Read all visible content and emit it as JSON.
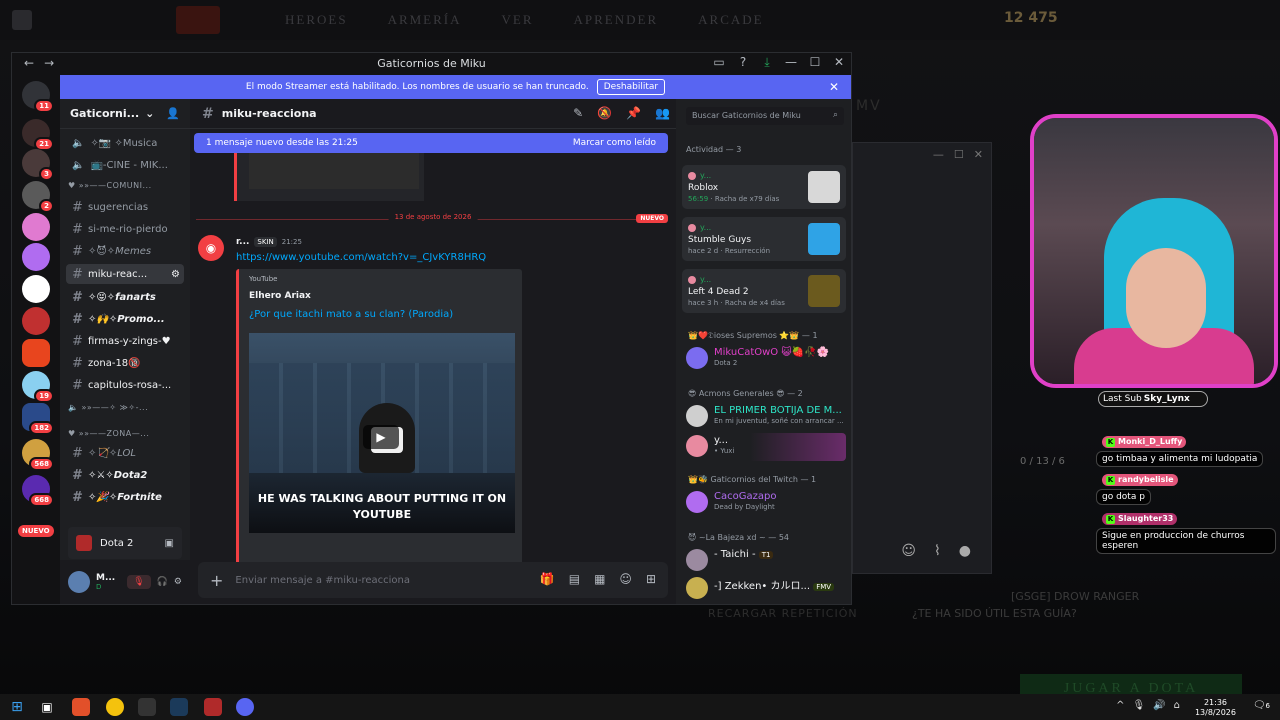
{
  "game": {
    "tabs": [
      "HEROES",
      "ARMERÍA",
      "VER",
      "APRENDER",
      "ARCADE"
    ],
    "gold": "12 475",
    "play_label": "JUGAR A DOTA",
    "footer_guide": "[GSGE] DROW RANGER",
    "footer_question": "¿TE HA SIDO ÚTIL ESTA GUÍA?",
    "footer_recharge": "RECARGAR REPETICIÓN",
    "score": "0 / 13 / 6",
    "mv": "MV"
  },
  "discord": {
    "window_title": "Gaticornios de Miku",
    "banner_text": "El modo Streamer está habilitado. Los nombres de usuario se han truncado.",
    "banner_button": "Deshabilitar",
    "server_name": "Gaticorni...",
    "channels": [
      {
        "label": "✧📷 ✧Musica",
        "type": "voice"
      },
      {
        "label": "📺-CINE - MIK...",
        "type": "voice"
      },
      {
        "label": "♥ »»——COMUNI...",
        "type": "category"
      },
      {
        "label": "sugerencias",
        "type": "text"
      },
      {
        "label": "si-me-rio-pierdo",
        "type": "text"
      },
      {
        "label": "✧😈✧Memes",
        "type": "text"
      },
      {
        "label": "miku-reac...",
        "type": "active"
      },
      {
        "label": "✧😝✧fanarts",
        "type": "unread"
      },
      {
        "label": "✧🙌✧Promo...",
        "type": "unread"
      },
      {
        "label": "firmas-y-zings-♥",
        "type": "text"
      },
      {
        "label": "zona-18🔞",
        "type": "text"
      },
      {
        "label": "capitulos-rosa-...",
        "type": "text"
      },
      {
        "label": "🔈 »»——✧ ≫✧-...",
        "type": "category"
      },
      {
        "label": "♥ »»——ZONA—...",
        "type": "category"
      },
      {
        "label": "✧🏹✧LOL",
        "type": "text"
      },
      {
        "label": "✧⚔✧Dota2",
        "type": "unread"
      },
      {
        "label": "✧🎉✧Fortnite",
        "type": "unread"
      }
    ],
    "voice_game": "Dota 2",
    "user_short": "M...",
    "user_sub": "D",
    "guild_badges": [
      "11",
      "21",
      "3",
      "2",
      "19",
      "182",
      "568",
      "668"
    ],
    "guild_nuevo": "NUEVO",
    "channel_name": "miku-reacciona",
    "new_msg_text": "1 mensaje nuevo desde las 21:25",
    "mark_read": "Marcar como leído",
    "divider_date": "13 de agosto de 2026",
    "divider_new": "NUEVO",
    "message": {
      "author": "r...",
      "tag": "SKIN",
      "time": "21:25",
      "link": "https://www.youtube.com/watch?v=_CJvKYR8HRQ",
      "embed_provider": "YouTube",
      "embed_author": "Elhero Ariax",
      "embed_title": "¿Por que itachi mato a su clan? (Parodia)",
      "video_caption": "HE WAS TALKING ABOUT PUTTING IT ON YOUTUBE"
    },
    "composer_placeholder": "Enviar mensaje a #miku-reacciona",
    "search_placeholder": "Buscar Gaticornios de Miku",
    "activity_header": "Actividad — 3",
    "activities": [
      {
        "user": "y...",
        "game": "Roblox",
        "meta_time": "56:59",
        "meta_extra": "Racha de x79 días",
        "art": "#d8d8d8"
      },
      {
        "user": "y...",
        "game": "Stumble Guys",
        "meta_time": "hace 2 d",
        "meta_extra": "Resurrección",
        "art": "#2fa3e6"
      },
      {
        "user": "y...",
        "game": "Left 4 Dead 2",
        "meta_time": "hace 3 h",
        "meta_extra": "Racha de x4 días",
        "art": "#6b5a1e"
      }
    ],
    "roles": [
      {
        "label": "👑❤️𝔇ioses Supremos ⭐👑 — 1",
        "members": [
          {
            "name": "MikuCatOwO 😺🍓🥀🌸",
            "sub": "Dota 2",
            "color": "#e040c8",
            "av": "#7b6cf0"
          }
        ]
      },
      {
        "label": "😎 Acmons Generales 😎 — 2",
        "members": [
          {
            "name": "EL PRIMER BOTIJA DE M...",
            "sub": "En mi juventud, soñé con arrancar ...",
            "color": "#2ee6c8",
            "av": "#cfcfcf"
          },
          {
            "name": "y...",
            "sub": "• Yuxi",
            "color": "#f2f3f5",
            "av": "#e88aa0"
          }
        ]
      },
      {
        "label": "👑🐝 Gaticornios del Twitch — 1",
        "members": [
          {
            "name": "CacoGazapo",
            "sub": "Dead by Daylight",
            "color": "#b06cf0",
            "av": "#b06cf0"
          }
        ]
      },
      {
        "label": "😈 ~La Bajeza xd ~ — 54",
        "members": [
          {
            "name": "- Taichi -",
            "sub": "",
            "color": "#f2f3f5",
            "av": "#9b8aa0"
          },
          {
            "name": "-] Zekken• カルロ...",
            "sub": "",
            "color": "#f2f3f5",
            "av": "#c8b050"
          }
        ]
      }
    ],
    "tag_t1": "T1",
    "tag_fmv": "FMV"
  },
  "stream": {
    "last_sub_label": "Last Sub",
    "last_sub_name": "Sky_Lynx",
    "chat": [
      {
        "user": "Monki_D_Luffy",
        "text": "go timbaa y alimenta mi ludopatia"
      },
      {
        "user": "randybelisle",
        "text": "go dota p"
      },
      {
        "user": "Slaughter33",
        "text": "Sigue en produccion de churros esperen"
      }
    ]
  },
  "taskbar": {
    "time": "21:36",
    "date": "13/8/2026",
    "notif": "6"
  }
}
